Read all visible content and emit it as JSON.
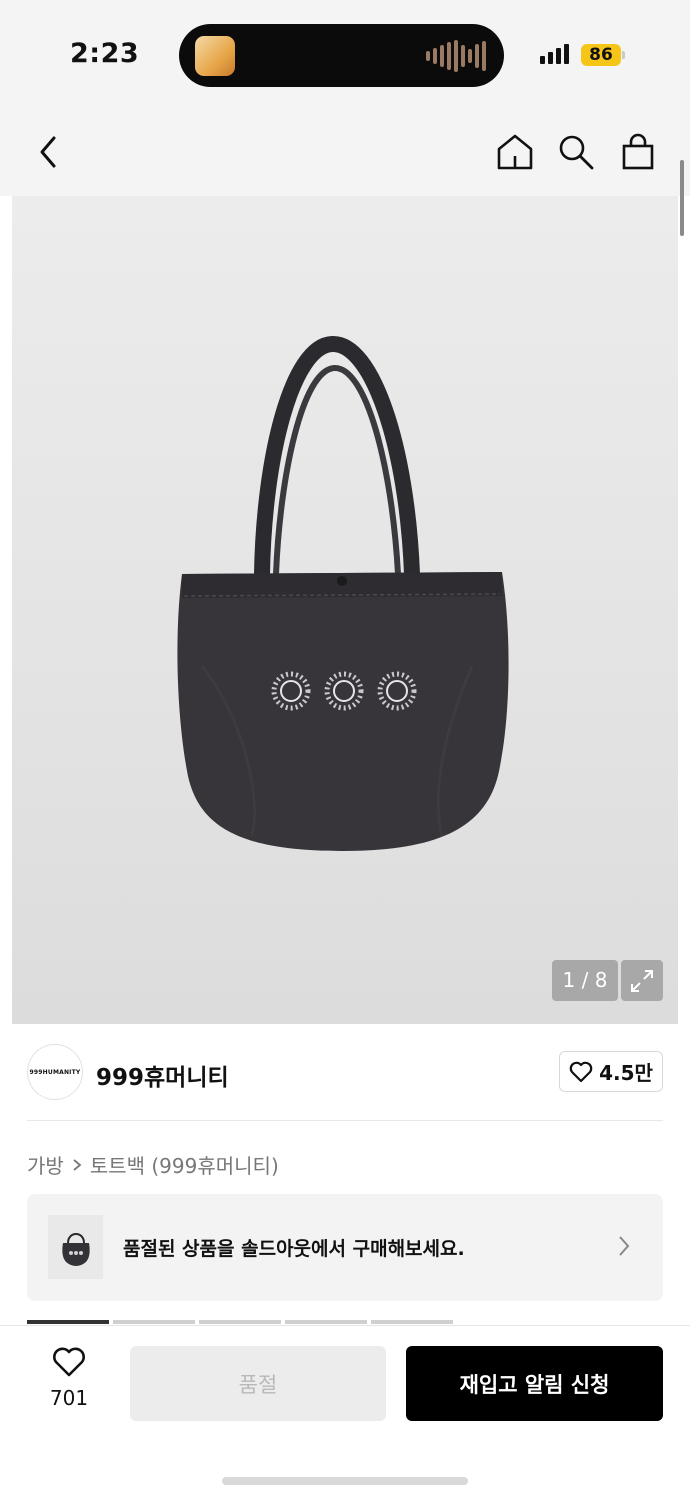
{
  "status_bar": {
    "time": "2:23",
    "battery": "86",
    "signal_icon": "cellular-signal-icon",
    "battery_color": "#f5c518"
  },
  "nav": {
    "back_icon": "chevron-left-icon",
    "home_icon": "home-icon",
    "search_icon": "search-icon",
    "cart_icon": "shopping-bag-icon"
  },
  "gallery": {
    "counter": "1 / 8",
    "expand_icon": "expand-icon"
  },
  "brand": {
    "logo_text": "999HUMANITY",
    "name": "999휴머니티",
    "likes": "4.5만"
  },
  "breadcrumb": {
    "category": "가방",
    "subcategory": "토트백 (999휴머니티)"
  },
  "soldout_notice": {
    "text": "품절된 상품을 솔드아웃에서 구매해보세요."
  },
  "bottom_bar": {
    "wish_count": "701",
    "soldout_label": "품절",
    "restock_label": "재입고 알림 신청"
  }
}
